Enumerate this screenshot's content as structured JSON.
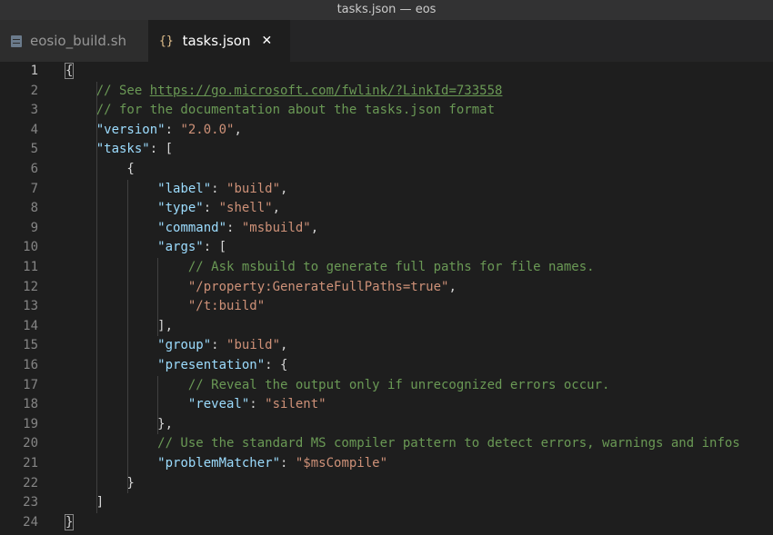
{
  "window": {
    "title": "tasks.json — eos"
  },
  "tabs": [
    {
      "label": "eosio_build.sh",
      "icon": "shell-file-icon"
    },
    {
      "label": "tasks.json",
      "icon": "json-braces-icon",
      "icon_glyph": "{}",
      "close": "✕"
    }
  ],
  "editor": {
    "lines": [
      {
        "n": "1",
        "tokens": [
          {
            "t": "{",
            "c": "p"
          }
        ]
      },
      {
        "n": "2",
        "tokens": [
          {
            "t": "    // See ",
            "c": "c"
          },
          {
            "t": "https://go.microsoft.com/fwlink/?LinkId=733558",
            "c": "u"
          }
        ]
      },
      {
        "n": "3",
        "tokens": [
          {
            "t": "    // for the documentation about the tasks.json format",
            "c": "c"
          }
        ]
      },
      {
        "n": "4",
        "tokens": [
          {
            "t": "    ",
            "c": "p"
          },
          {
            "t": "\"version\"",
            "c": "k"
          },
          {
            "t": ": ",
            "c": "p"
          },
          {
            "t": "\"2.0.0\"",
            "c": "s"
          },
          {
            "t": ",",
            "c": "p"
          }
        ]
      },
      {
        "n": "5",
        "tokens": [
          {
            "t": "    ",
            "c": "p"
          },
          {
            "t": "\"tasks\"",
            "c": "k"
          },
          {
            "t": ": [",
            "c": "p"
          }
        ]
      },
      {
        "n": "6",
        "tokens": [
          {
            "t": "        {",
            "c": "p"
          }
        ]
      },
      {
        "n": "7",
        "tokens": [
          {
            "t": "            ",
            "c": "p"
          },
          {
            "t": "\"label\"",
            "c": "k"
          },
          {
            "t": ": ",
            "c": "p"
          },
          {
            "t": "\"build\"",
            "c": "s"
          },
          {
            "t": ",",
            "c": "p"
          }
        ]
      },
      {
        "n": "8",
        "tokens": [
          {
            "t": "            ",
            "c": "p"
          },
          {
            "t": "\"type\"",
            "c": "k"
          },
          {
            "t": ": ",
            "c": "p"
          },
          {
            "t": "\"shell\"",
            "c": "s"
          },
          {
            "t": ",",
            "c": "p"
          }
        ]
      },
      {
        "n": "9",
        "tokens": [
          {
            "t": "            ",
            "c": "p"
          },
          {
            "t": "\"command\"",
            "c": "k"
          },
          {
            "t": ": ",
            "c": "p"
          },
          {
            "t": "\"msbuild\"",
            "c": "s"
          },
          {
            "t": ",",
            "c": "p"
          }
        ]
      },
      {
        "n": "10",
        "tokens": [
          {
            "t": "            ",
            "c": "p"
          },
          {
            "t": "\"args\"",
            "c": "k"
          },
          {
            "t": ": [",
            "c": "p"
          }
        ]
      },
      {
        "n": "11",
        "tokens": [
          {
            "t": "                // Ask msbuild to generate full paths for file names.",
            "c": "c"
          }
        ]
      },
      {
        "n": "12",
        "tokens": [
          {
            "t": "                ",
            "c": "p"
          },
          {
            "t": "\"/property:GenerateFullPaths=true\"",
            "c": "s"
          },
          {
            "t": ",",
            "c": "p"
          }
        ]
      },
      {
        "n": "13",
        "tokens": [
          {
            "t": "                ",
            "c": "p"
          },
          {
            "t": "\"/t:build\"",
            "c": "s"
          }
        ]
      },
      {
        "n": "14",
        "tokens": [
          {
            "t": "            ],",
            "c": "p"
          }
        ]
      },
      {
        "n": "15",
        "tokens": [
          {
            "t": "            ",
            "c": "p"
          },
          {
            "t": "\"group\"",
            "c": "k"
          },
          {
            "t": ": ",
            "c": "p"
          },
          {
            "t": "\"build\"",
            "c": "s"
          },
          {
            "t": ",",
            "c": "p"
          }
        ]
      },
      {
        "n": "16",
        "tokens": [
          {
            "t": "            ",
            "c": "p"
          },
          {
            "t": "\"presentation\"",
            "c": "k"
          },
          {
            "t": ": {",
            "c": "p"
          }
        ]
      },
      {
        "n": "17",
        "tokens": [
          {
            "t": "                // Reveal the output only if unrecognized errors occur.",
            "c": "c"
          }
        ]
      },
      {
        "n": "18",
        "tokens": [
          {
            "t": "                ",
            "c": "p"
          },
          {
            "t": "\"reveal\"",
            "c": "k"
          },
          {
            "t": ": ",
            "c": "p"
          },
          {
            "t": "\"silent\"",
            "c": "s"
          }
        ]
      },
      {
        "n": "19",
        "tokens": [
          {
            "t": "            },",
            "c": "p"
          }
        ]
      },
      {
        "n": "20",
        "tokens": [
          {
            "t": "            // Use the standard MS compiler pattern to detect errors, warnings and infos",
            "c": "c"
          }
        ]
      },
      {
        "n": "21",
        "tokens": [
          {
            "t": "            ",
            "c": "p"
          },
          {
            "t": "\"problemMatcher\"",
            "c": "k"
          },
          {
            "t": ": ",
            "c": "p"
          },
          {
            "t": "\"$msCompile\"",
            "c": "s"
          }
        ]
      },
      {
        "n": "22",
        "tokens": [
          {
            "t": "        }",
            "c": "p"
          }
        ]
      },
      {
        "n": "23",
        "tokens": [
          {
            "t": "    ]",
            "c": "p"
          }
        ]
      },
      {
        "n": "24",
        "tokens": [
          {
            "t": "}",
            "c": "p"
          }
        ]
      }
    ],
    "current_line": "1"
  }
}
